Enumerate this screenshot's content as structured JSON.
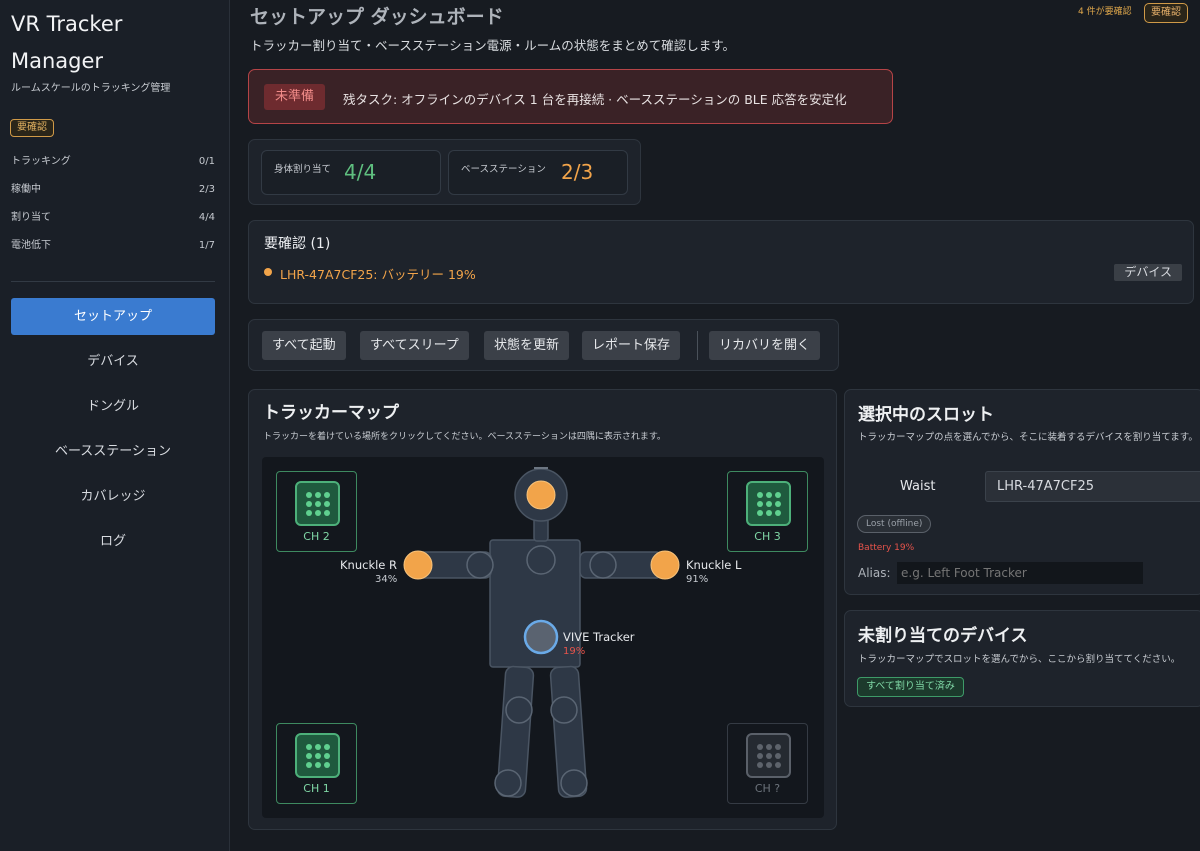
{
  "sidebar": {
    "title": "VR Tracker Manager",
    "subtitle": "ルームスケールのトラッキング管理",
    "badge": "要確認",
    "stats": [
      {
        "label": "トラッキング",
        "value": "0/1"
      },
      {
        "label": "稼働中",
        "value": "2/3"
      },
      {
        "label": "割り当て",
        "value": "4/4"
      },
      {
        "label": "電池低下",
        "value": "1/7"
      }
    ],
    "nav": [
      {
        "label": "セットアップ",
        "active": true
      },
      {
        "label": "デバイス"
      },
      {
        "label": "ドングル"
      },
      {
        "label": "ベースステーション"
      },
      {
        "label": "カバレッジ"
      },
      {
        "label": "ログ"
      }
    ]
  },
  "header": {
    "title": "セットアップ ダッシュボード",
    "subtitle": "トラッカー割り当て・ベースステーション電源・ルームの状態をまとめて確認します。",
    "count_text": "4 件が要確認",
    "badge": "要確認"
  },
  "alert": {
    "chip": "未準備",
    "text": "残タスク: オフラインのデバイス 1 台を再接続 · ベースステーションの BLE 応答を安定化"
  },
  "summary": {
    "body": {
      "label": "身体割り当て",
      "value": "4/4"
    },
    "stations": {
      "label": "ベースステーション",
      "value": "2/3"
    }
  },
  "review": {
    "title": "要確認 (1)",
    "item": "LHR-47A7CF25: バッテリー 19%",
    "tag": "デバイス"
  },
  "toolbar": {
    "buttons": [
      "すべて起動",
      "すべてスリープ",
      "状態を更新",
      "レポート保存",
      "リカバリを開く"
    ]
  },
  "map": {
    "title": "トラッカーマップ",
    "subtitle": "トラッカーを着けている場所をクリックしてください。ベースステーションは四隅に表示されます。",
    "stations": [
      "CH 2",
      "CH 3",
      "CH 1",
      "CH ?"
    ],
    "devices": {
      "knuckle_r": {
        "label": "Knuckle R",
        "pct": "34%"
      },
      "knuckle_l": {
        "label": "Knuckle L",
        "pct": "91%"
      },
      "vive": {
        "label": "VIVE Tracker",
        "pct": "19%"
      }
    }
  },
  "slot": {
    "title": "選択中のスロット",
    "desc": "トラッカーマップの点を選んでから、そこに装着するデバイスを割り当てます。",
    "name": "Waist",
    "selected": "LHR-47A7CF25",
    "status": "Lost (offline)",
    "battery": "Battery 19%",
    "alias_label": "Alias:",
    "alias_placeholder": "e.g. Left Foot Tracker"
  },
  "unassigned": {
    "title": "未割り当てのデバイス",
    "desc": "トラッカーマップでスロットを選んでから、ここから割り当ててください。",
    "chip": "すべて割り当て済み"
  },
  "colors": {
    "accent": "#3a7bd0",
    "warn": "#f2a44a",
    "ok": "#5fd08f",
    "danger": "#e5534b"
  }
}
